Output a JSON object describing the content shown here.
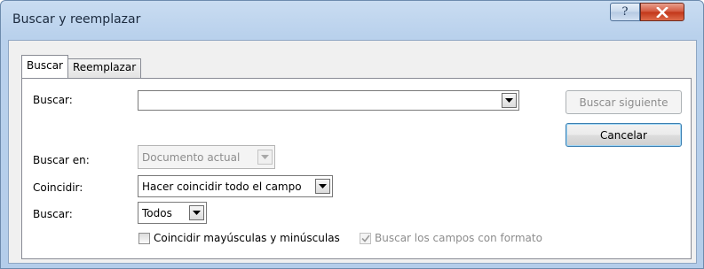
{
  "window": {
    "title": "Buscar y reemplazar",
    "help_label": "?"
  },
  "tabs": [
    {
      "label": "Buscar",
      "active": true
    },
    {
      "label": "Reemplazar",
      "active": false
    }
  ],
  "form": {
    "find_label": "Buscar:",
    "find_value": "",
    "look_in_label": "Buscar en:",
    "look_in_value": "Documento actual",
    "match_label": "Coincidir:",
    "match_value": "Hacer coincidir todo el campo",
    "search_label": "Buscar:",
    "search_value": "Todos",
    "match_case_label": "Coincidir mayúsculas y minúsculas",
    "match_case_checked": false,
    "formatted_label": "Buscar los campos con formato",
    "formatted_checked": true
  },
  "buttons": {
    "find_next": "Buscar siguiente",
    "cancel": "Cancelar"
  },
  "icons": {
    "help": "question-mark-icon",
    "close": "close-x-icon",
    "dropdown": "triangle-down-icon",
    "check": "checkmark-icon"
  },
  "colors": {
    "title_bar": "#b9d1ec",
    "close_button": "#c23518",
    "default_button_border": "#3c7fb1"
  }
}
